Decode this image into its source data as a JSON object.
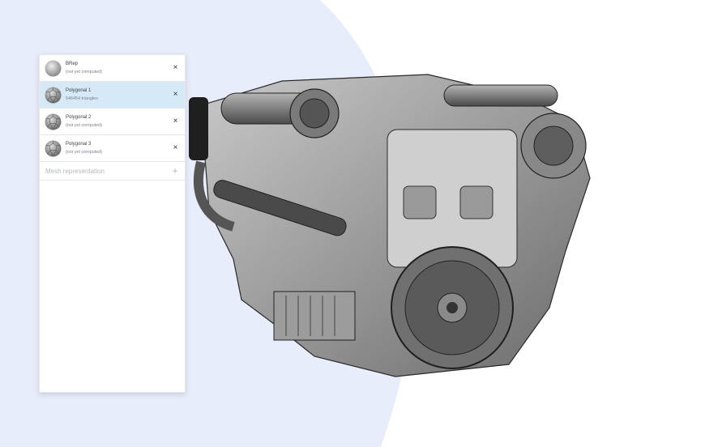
{
  "colors": {
    "background": "#ffffff",
    "blob": "#e8edfb",
    "selected_row": "#d6e9f7"
  },
  "mesh_list": {
    "items": [
      {
        "title": "BRep",
        "subtitle": "(not yet computed)",
        "icon": "sphere-icon",
        "selected": false
      },
      {
        "title": "Polygonal 1",
        "subtitle": "546454 triangles",
        "icon": "mesh-sphere-icon",
        "selected": true
      },
      {
        "title": "Polygonal 2",
        "subtitle": "(not yet computed)",
        "icon": "mesh-sphere-icon",
        "selected": false
      },
      {
        "title": "Polygonal 3",
        "subtitle": "(not yet computed)",
        "icon": "mesh-sphere-icon",
        "selected": false
      }
    ],
    "close_glyph": "×",
    "add_placeholder": "Mesh representation",
    "add_glyph": "+"
  },
  "viewport": {
    "model": "engine-model"
  }
}
